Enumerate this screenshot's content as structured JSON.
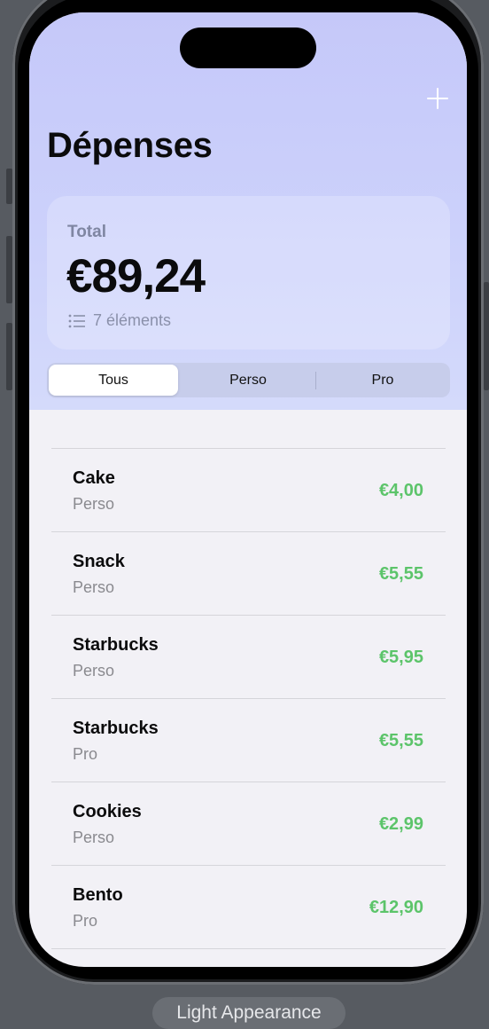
{
  "header": {
    "title": "Dépenses",
    "add_icon": "plus-icon"
  },
  "summary": {
    "label": "Total",
    "value": "€89,24",
    "count_text": "7 éléments",
    "count_icon": "list-icon"
  },
  "filter": {
    "options": [
      "Tous",
      "Perso",
      "Pro"
    ],
    "selected": "Tous"
  },
  "expenses": [
    {
      "name": "Cake",
      "category": "Perso",
      "amount": "€4,00"
    },
    {
      "name": "Snack",
      "category": "Perso",
      "amount": "€5,55"
    },
    {
      "name": "Starbucks",
      "category": "Perso",
      "amount": "€5,95"
    },
    {
      "name": "Starbucks",
      "category": "Pro",
      "amount": "€5,55"
    },
    {
      "name": "Cookies",
      "category": "Perso",
      "amount": "€2,99"
    },
    {
      "name": "Bento",
      "category": "Pro",
      "amount": "€12,90"
    }
  ],
  "colors": {
    "amount": "#5cc46a",
    "header_gradient": "#c5c8f9"
  },
  "footer": {
    "appearance_label": "Light Appearance"
  }
}
